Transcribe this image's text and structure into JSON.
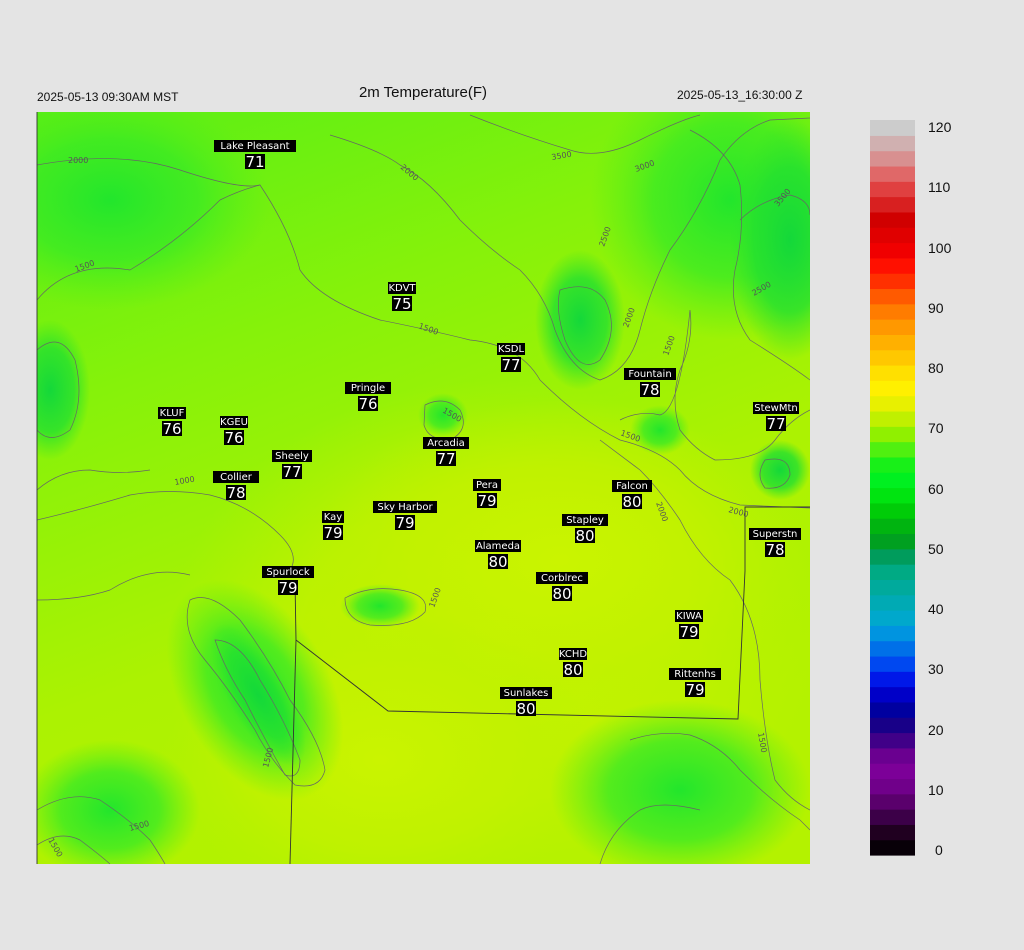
{
  "header": {
    "local_time": "2025-05-13 09:30AM MST",
    "title": "2m Temperature(F)",
    "utc_time": "2025-05-13_16:30:00 Z"
  },
  "colors": {
    "background": "#e4e4e4",
    "field_warm": "#c8f200",
    "field_mid": "#8ef200",
    "field_cool": "#4aec1c",
    "contour": "#666666",
    "label_bg": "#000000",
    "label_text": "#ffffff"
  },
  "stations": [
    {
      "name": "Lake Pleasant",
      "value": "71"
    },
    {
      "name": "KDVT",
      "value": "75"
    },
    {
      "name": "KSDL",
      "value": "77"
    },
    {
      "name": "Fountain",
      "value": "78"
    },
    {
      "name": "Pringle",
      "value": "76"
    },
    {
      "name": "KLUF",
      "value": "76"
    },
    {
      "name": "KGEU",
      "value": "76"
    },
    {
      "name": "StewMtn",
      "value": "77"
    },
    {
      "name": "Arcadia",
      "value": "77"
    },
    {
      "name": "Sheely",
      "value": "77"
    },
    {
      "name": "Collier",
      "value": "78"
    },
    {
      "name": "Pera",
      "value": "79"
    },
    {
      "name": "Falcon",
      "value": "80"
    },
    {
      "name": "Kay",
      "value": "79"
    },
    {
      "name": "Sky Harbor",
      "value": "79"
    },
    {
      "name": "Stapley",
      "value": "80"
    },
    {
      "name": "Superstn",
      "value": "78"
    },
    {
      "name": "Alameda",
      "value": "80"
    },
    {
      "name": "Spurlock",
      "value": "79"
    },
    {
      "name": "Corblrec",
      "value": "80"
    },
    {
      "name": "KIWA",
      "value": "79"
    },
    {
      "name": "KCHD",
      "value": "80"
    },
    {
      "name": "Rittenhs",
      "value": "79"
    },
    {
      "name": "Sunlakes",
      "value": "80"
    }
  ],
  "contour_labels": [
    "2000",
    "1500",
    "1000",
    "2000",
    "1500",
    "2500",
    "2000",
    "3000",
    "3500",
    "3500",
    "2500",
    "2000",
    "1500",
    "1500",
    "2000",
    "1500",
    "1500",
    "1500",
    "1500",
    "1500",
    "1500"
  ],
  "colorbar": {
    "ticks": [
      "120",
      "110",
      "100",
      "90",
      "80",
      "70",
      "60",
      "50",
      "40",
      "30",
      "20",
      "10",
      "0"
    ],
    "colors": [
      "#080008",
      "#200020",
      "#3c0048",
      "#5a006c",
      "#70008a",
      "#7c0098",
      "#6a0090",
      "#400088",
      "#180088",
      "#0000a0",
      "#0000c8",
      "#0018e8",
      "#0048f0",
      "#0070e8",
      "#0094e0",
      "#00a8cc",
      "#00aab4",
      "#00aa9c",
      "#00aa84",
      "#009c5c",
      "#00a020",
      "#00b410",
      "#00cc08",
      "#00e410",
      "#00f020",
      "#18f018",
      "#50f010",
      "#90f000",
      "#c0f000",
      "#e8f000",
      "#fff000",
      "#ffe000",
      "#ffc800",
      "#ffb000",
      "#ff9800",
      "#ff7c00",
      "#ff5a00",
      "#ff3000",
      "#ff1000",
      "#f00000",
      "#e00000",
      "#d00000",
      "#d82020",
      "#e04040",
      "#e06868",
      "#d89090",
      "#d0b0b0",
      "#cccccc"
    ]
  }
}
